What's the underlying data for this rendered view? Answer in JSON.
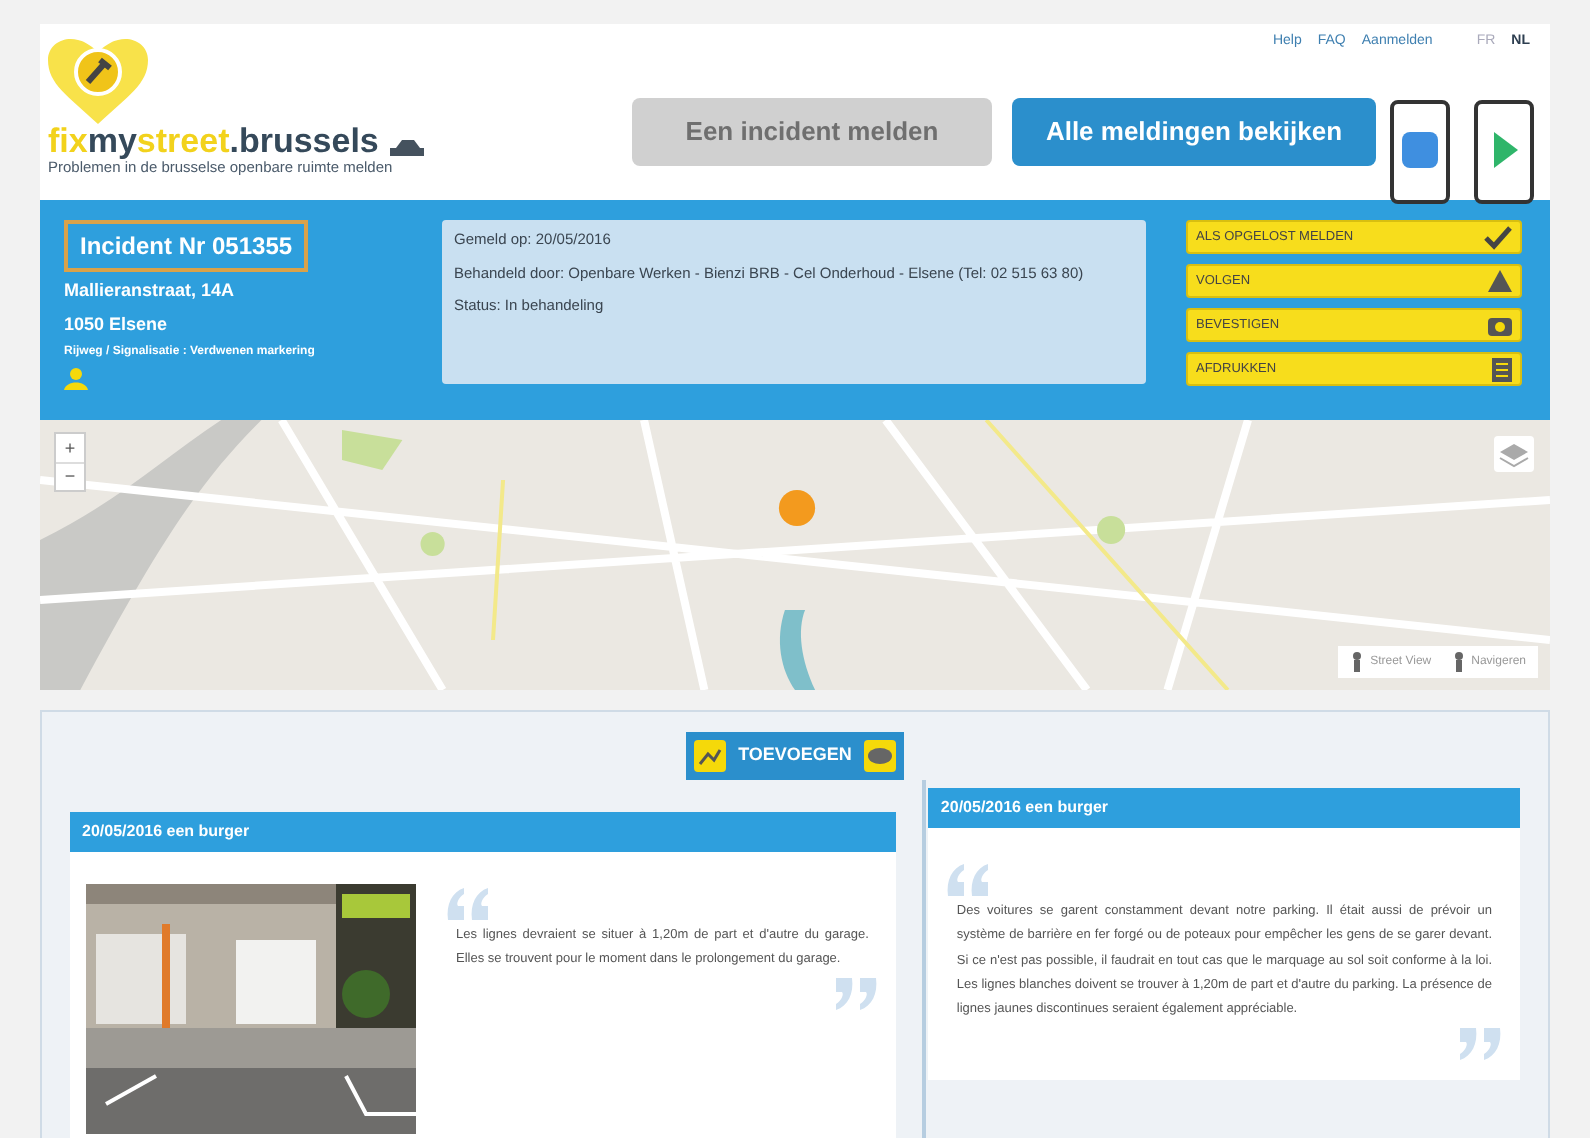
{
  "top_links": [
    {
      "label": "Help"
    },
    {
      "label": "FAQ"
    },
    {
      "label": "Aanmelden"
    }
  ],
  "languages": [
    {
      "label": "FR",
      "selected": false
    },
    {
      "label": "NL",
      "selected": true
    }
  ],
  "logo": {
    "parts": [
      {
        "text": "fix",
        "kind": "accent"
      },
      {
        "text": "my",
        "kind": "dark"
      },
      {
        "text": "street",
        "kind": "accent"
      },
      {
        "text": ".brussels",
        "kind": "dark"
      }
    ],
    "tagline": "Problemen in de brusselse openbare ruimte melden"
  },
  "actions": [
    {
      "label": "Een incident melden",
      "disabled": true
    },
    {
      "label": "Alle meldingen bekijken",
      "disabled": false
    }
  ],
  "incident": {
    "number": "Incident Nr 051355",
    "street": "Mallieranstraat, 14A",
    "city": "1050 Elsene",
    "category": "Rijweg / Signalisatie : Verdwenen markering",
    "details": [
      "Gemeld op: 20/05/2016",
      "Behandeld door: Openbare Werken - Bienzi BRB - Cel Onderhoud - Elsene (Tel: 02 515 63 80)",
      "Status: In behandeling"
    ],
    "buttons": [
      {
        "label": "ALS OPGELOST MELDEN",
        "kind": "check"
      },
      {
        "label": "VOLGEN",
        "kind": "alert"
      },
      {
        "label": "BEVESTIGEN",
        "kind": "camera"
      },
      {
        "label": "AFDRUKKEN",
        "kind": "doc"
      }
    ]
  },
  "map": {
    "zoom_in": "+",
    "zoom_out": "−",
    "tools": [
      {
        "label": "Street View"
      },
      {
        "label": "Navigeren"
      }
    ]
  },
  "add_button": "TOEVOEGEN",
  "comments": [
    {
      "header": "20/05/2016 een burger",
      "has_photo": true,
      "text": "Les lignes devraient se situer à 1,20m de part et d'autre du garage. Elles se trouvent pour le moment dans le prolongement du garage."
    },
    {
      "header": "20/05/2016 een burger",
      "has_photo": false,
      "text": "Des voitures se garent constamment devant notre parking. Il était aussi de prévoir un système de barrière en fer forgé ou de poteaux pour empêcher les gens de se garer devant. Si ce n'est pas possible, il faudrait en tout cas que le marquage au sol soit conforme à la loi. Les lignes blanches doivent se trouver à 1,20m de part et d'autre du parking. La présence de lignes jaunes discontinues seraient également appréciable."
    }
  ]
}
